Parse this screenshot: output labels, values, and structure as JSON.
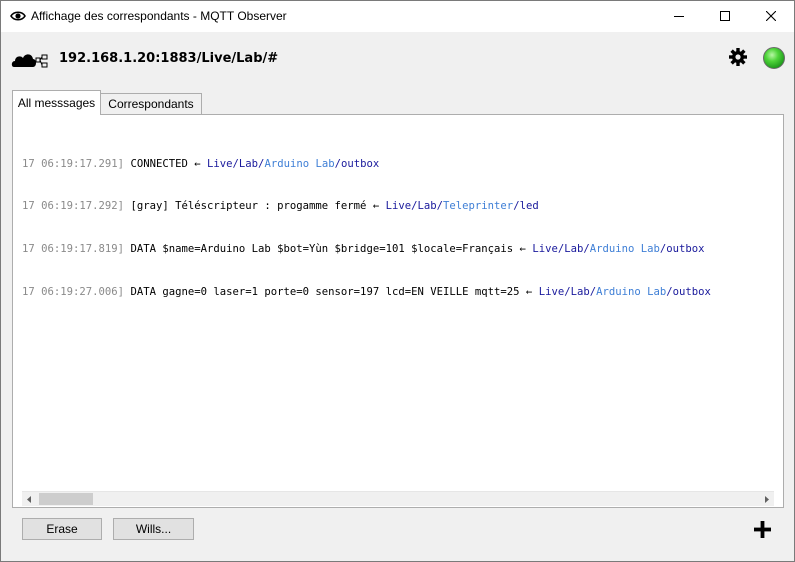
{
  "window": {
    "title": "Affichage des correspondants - MQTT Observer"
  },
  "header": {
    "broker": "192.168.1.20:1883/Live/Lab/#",
    "status_color": "#3fcf32"
  },
  "tabs": [
    {
      "label": "All messsages",
      "active": true
    },
    {
      "label": "Correspondants",
      "active": false
    }
  ],
  "log": [
    {
      "ts": "17 06:19:17.291]",
      "msg": "CONNECTED",
      "arrow": "←",
      "p1": "Live/Lab/",
      "p2": "Arduino Lab",
      "p3": "/outbox"
    },
    {
      "ts": "17 06:19:17.292]",
      "msg": "[gray] Téléscripteur : progamme fermé",
      "arrow": "←",
      "p1": "Live/Lab/",
      "p2": "Teleprinter",
      "p3": "/led"
    },
    {
      "ts": "17 06:19:17.819]",
      "msg": "DATA $name=Arduino Lab $bot=Yùn $bridge=101 $locale=Français",
      "arrow": "←",
      "p1": "Live/Lab/",
      "p2": "Arduino Lab",
      "p3": "/outbox"
    },
    {
      "ts": "17 06:19:27.006]",
      "msg": "DATA gagne=0 laser=1 porte=0 sensor=197 lcd=EN VEILLE mqtt=25",
      "arrow": "←",
      "p1": "Live/Lab/",
      "p2": "Arduino Lab",
      "p3": "/outbox"
    }
  ],
  "buttons": {
    "erase": "Erase",
    "wills": "Wills..."
  },
  "icons": {
    "title": "eye-icon",
    "broker": "cloud-network-icon",
    "settings": "gear-icon",
    "status": "status-led",
    "add": "plus-icon"
  }
}
